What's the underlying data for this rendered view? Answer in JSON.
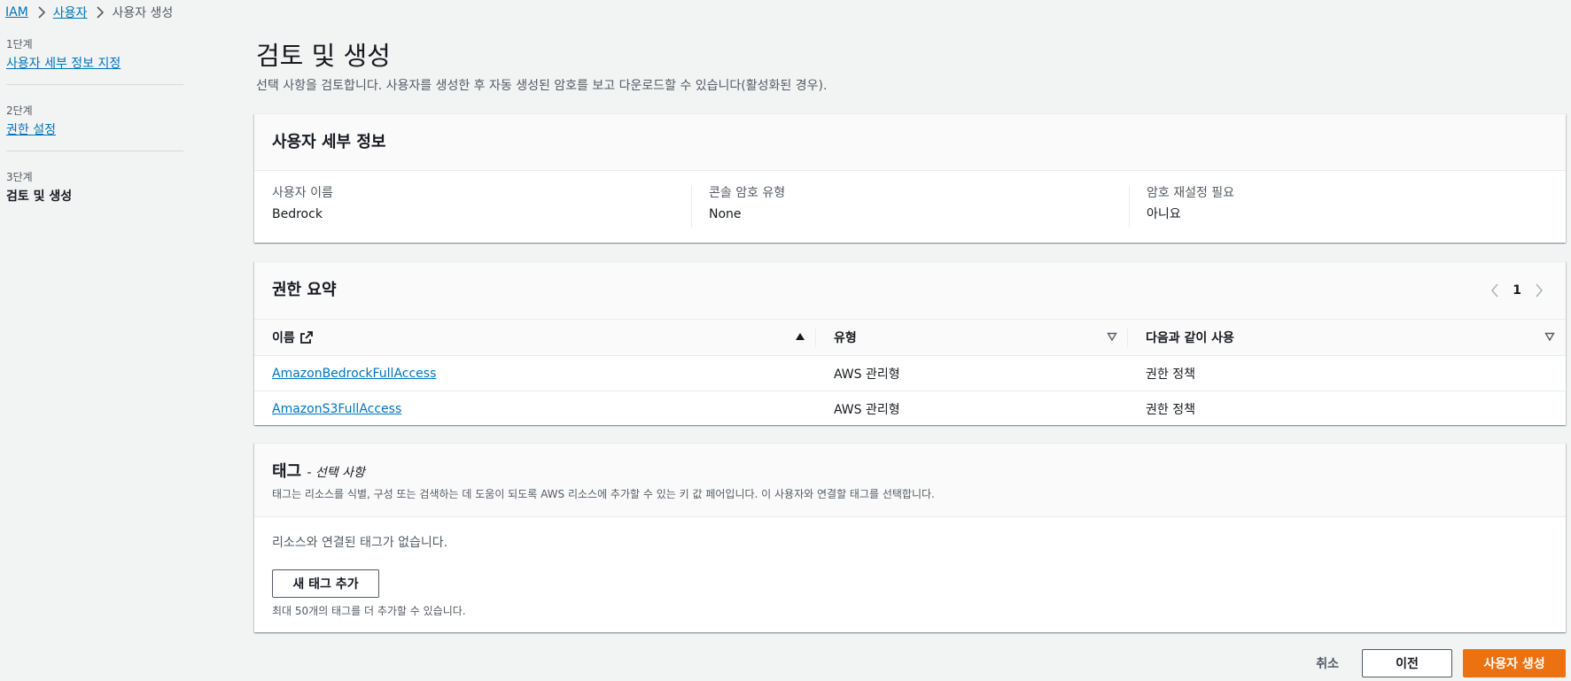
{
  "breadcrumb": {
    "items": [
      "IAM",
      "사용자",
      "사용자 생성"
    ]
  },
  "steps": [
    {
      "num": "1단계",
      "label": "사용자 세부 정보 지정"
    },
    {
      "num": "2단계",
      "label": "권한 설정"
    },
    {
      "num": "3단계",
      "label": "검토 및 생성"
    }
  ],
  "page": {
    "title": "검토 및 생성",
    "description": "선택 사항을 검토합니다. 사용자를 생성한 후 자동 생성된 암호를 보고 다운로드할 수 있습니다(활성화된 경우)."
  },
  "user_details": {
    "title": "사용자 세부 정보",
    "fields": [
      {
        "key": "사용자 이름",
        "value": "Bedrock"
      },
      {
        "key": "콘솔 암호 유형",
        "value": "None"
      },
      {
        "key": "암호 재설정 필요",
        "value": "아니요"
      }
    ]
  },
  "permissions": {
    "title": "권한 요약",
    "page_number": "1",
    "columns": [
      "이름",
      "유형",
      "다음과 같이 사용"
    ],
    "rows": [
      {
        "name": "AmazonBedrockFullAccess",
        "type": "AWS 관리형",
        "usage": "권한 정책"
      },
      {
        "name": "AmazonS3FullAccess",
        "type": "AWS 관리형",
        "usage": "권한 정책"
      }
    ]
  },
  "tags": {
    "title": "태그",
    "optional": "- 선택 사항",
    "description": "태그는 리소스를 식별, 구성 또는 검색하는 데 도움이 되도록 AWS 리소스에 추가할 수 있는 키 값 페어입니다. 이 사용자와 연결할 태그를 선택합니다.",
    "empty_text": "리소스와 연결된 태그가 없습니다.",
    "add_button": "새 태그 추가",
    "hint": "최대 50개의 태그를 더 추가할 수 있습니다."
  },
  "footer": {
    "cancel": "취소",
    "previous": "이전",
    "create": "사용자 생성"
  },
  "colors": {
    "link": "#0073bb",
    "primary_button": "#ec7211",
    "background": "#f2f3f3"
  }
}
